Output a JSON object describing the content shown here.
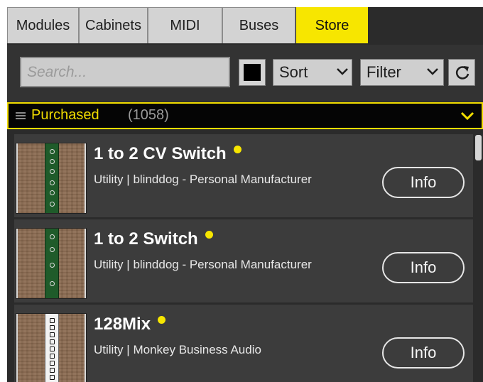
{
  "tabs": [
    {
      "label": "Modules"
    },
    {
      "label": "Cabinets"
    },
    {
      "label": "MIDI"
    },
    {
      "label": "Buses"
    },
    {
      "label": "Store",
      "active": true
    }
  ],
  "toolbar": {
    "search_placeholder": "Search...",
    "color_swatch": "#000000",
    "sort_label": "Sort",
    "filter_label": "Filter",
    "refresh_icon": "refresh-icon"
  },
  "section": {
    "title": "Purchased",
    "count": "(1058)",
    "menu_icon": "hamburger-icon",
    "collapse_icon": "chevron-down-icon"
  },
  "items": [
    {
      "name": "1 to 2 CV Switch",
      "category": "Utility",
      "separator": "|",
      "vendor": "blinddog - Personal Manufacturer",
      "info_label": "Info"
    },
    {
      "name": "1 to 2 Switch",
      "category": "Utility",
      "separator": "|",
      "vendor": "blinddog - Personal Manufacturer",
      "info_label": "Info"
    },
    {
      "name": "128Mix",
      "category": "Utility",
      "separator": "|",
      "vendor": "Monkey Business Audio",
      "info_label": "Info"
    }
  ],
  "colors": {
    "accent": "#f7e600",
    "background": "#2b2b2b",
    "list_item": "#3c3c3c",
    "header_bg": "#050505"
  }
}
